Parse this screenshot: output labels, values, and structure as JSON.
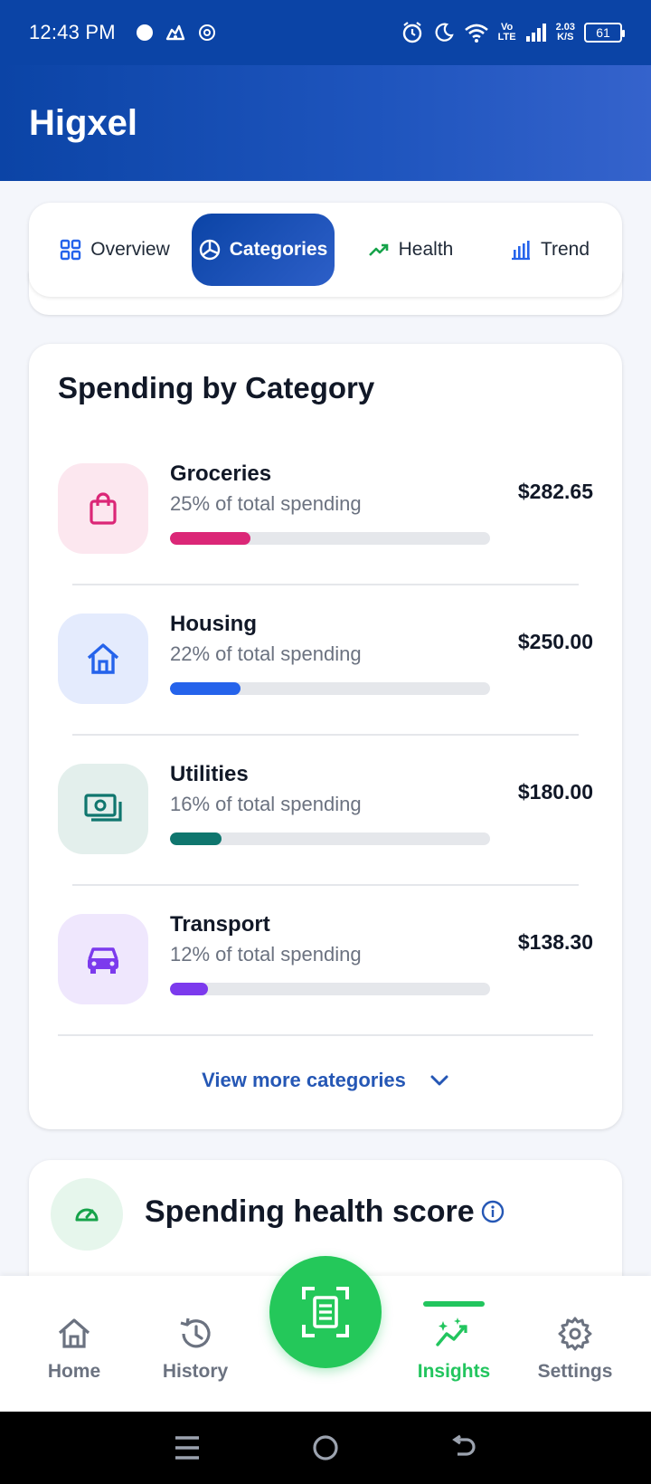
{
  "status_bar": {
    "time": "12:43 PM",
    "lte_top": "Vo",
    "lte_bottom": "LTE",
    "speed_value": "2.03",
    "speed_unit": "K/S",
    "battery": "61"
  },
  "header": {
    "title": "Higxel"
  },
  "tabs": [
    {
      "label": "Overview",
      "icon": "grid-icon"
    },
    {
      "label": "Categories",
      "icon": "pie-chart-icon",
      "selected": true
    },
    {
      "label": "Health",
      "icon": "trending-up-icon"
    },
    {
      "label": "Trend",
      "icon": "bar-chart-icon"
    }
  ],
  "categories_card": {
    "title": "Spending by Category",
    "items": [
      {
        "name": "Groceries",
        "subtitle": "25% of total spending",
        "amount": "$282.65",
        "percent": 25,
        "icon": "shopping-bag-icon",
        "color": "#db2777",
        "bg": "#fce7ef"
      },
      {
        "name": "Housing",
        "subtitle": "22% of total spending",
        "amount": "$250.00",
        "percent": 22,
        "icon": "house-icon",
        "color": "#2563eb",
        "bg": "#e4ebfd"
      },
      {
        "name": "Utilities",
        "subtitle": "16% of total spending",
        "amount": "$180.00",
        "percent": 16,
        "icon": "money-icon",
        "color": "#0f766e",
        "bg": "#e3efec"
      },
      {
        "name": "Transport",
        "subtitle": "12% of total spending",
        "amount": "$138.30",
        "percent": 12,
        "icon": "car-icon",
        "color": "#7c3aed",
        "bg": "#efe7fd"
      }
    ],
    "view_more": "View more categories"
  },
  "health_card": {
    "title": "Spending health score"
  },
  "bottom_nav": {
    "items": [
      {
        "label": "Home",
        "icon": "home-icon"
      },
      {
        "label": "History",
        "icon": "history-icon"
      },
      {
        "label": "Insights",
        "icon": "insights-icon",
        "active": true
      },
      {
        "label": "Settings",
        "icon": "gear-icon"
      }
    ],
    "fab_icon": "scan-receipt-icon",
    "active_color": "#22c55e"
  }
}
